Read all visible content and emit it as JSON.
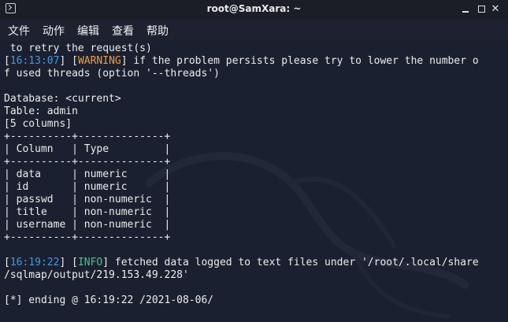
{
  "window": {
    "title": "root@SamXara: ~",
    "buttons": {
      "minimize": "minimize",
      "maximize": "maximize",
      "close": "✕"
    }
  },
  "menu": {
    "items": [
      "文件",
      "动作",
      "编辑",
      "查看",
      "帮助"
    ]
  },
  "terminal": {
    "line1": " to retry the request(s)",
    "warn_ts": "16:13:07",
    "warn_tag": "WARNING",
    "warn_msg": " if the problem persists please try to lower the number o",
    "warn_cont": "f used threads (option '--threads')",
    "db_line": "Database: <current>",
    "table_line": "Table: admin",
    "cols_line": "[5 columns]",
    "table_border": "+----------+--------------+",
    "table_header": "| Column   | Type         |",
    "rows": [
      "| data     | numeric      |",
      "| id       | numeric      |",
      "| passwd   | non-numeric  |",
      "| title    | non-numeric  |",
      "| username | non-numeric  |"
    ],
    "info_ts": "16:19:22",
    "info_tag": "INFO",
    "info_msg": " fetched data logged to text files under '/root/.local/share",
    "info_cont": "/sqlmap/output/219.153.49.228'",
    "ending": "[*] ending @ 16:19:22 /2021-08-06/"
  },
  "colors": {
    "background": "#1b2030",
    "timestamp": "#3f9be0",
    "warning": "#f1a03b",
    "info": "#4fc08d",
    "text": "#ececec"
  }
}
